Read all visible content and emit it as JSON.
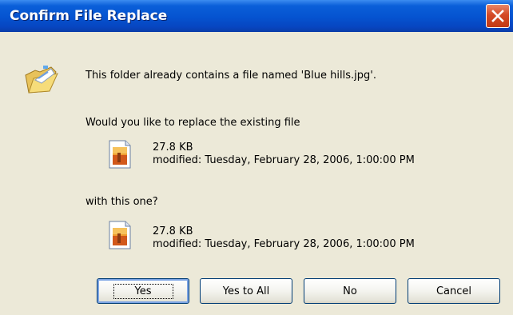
{
  "dialog": {
    "title": "Confirm File Replace",
    "message": "This folder already contains a file named 'Blue hills.jpg'.",
    "question": "Would you like to replace the existing file",
    "existing_file": {
      "size": "27.8 KB",
      "modified": "modified: Tuesday, February 28, 2006, 1:00:00 PM"
    },
    "with_text": "with this one?",
    "new_file": {
      "size": "27.8 KB",
      "modified": "modified: Tuesday, February 28, 2006, 1:00:00 PM"
    }
  },
  "buttons": {
    "yes": "Yes",
    "yes_to_all": "Yes to All",
    "no": "No",
    "cancel": "Cancel"
  },
  "icons": {
    "close": "close-icon",
    "folder": "folder-icon",
    "image_file": "image-file-icon"
  },
  "colors": {
    "title_bar": "#0553d0",
    "close_button": "#d44a26",
    "dialog_bg": "#ece9d8",
    "button_border": "#003c74"
  }
}
